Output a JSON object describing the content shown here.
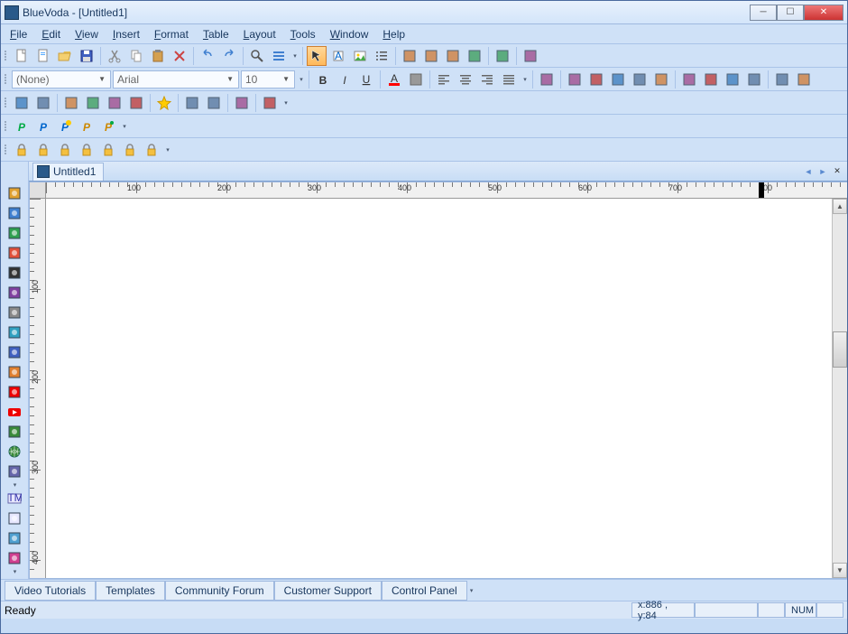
{
  "app": {
    "title": "BlueVoda - [Untitled1]"
  },
  "menu": [
    "File",
    "Edit",
    "View",
    "Insert",
    "Format",
    "Table",
    "Layout",
    "Tools",
    "Window",
    "Help"
  ],
  "toolbar1_icons": [
    "new-file",
    "page",
    "open",
    "save",
    "|",
    "cut",
    "copy",
    "paste",
    "delete",
    "|",
    "undo",
    "redo",
    "|",
    "zoom",
    "headers",
    "drop",
    "|",
    "cursor",
    "text-tool",
    "image-tool",
    "bullets",
    "|",
    "table-btn",
    "form-btn",
    "shape",
    "button",
    "|",
    "preview",
    "|",
    "publish"
  ],
  "format_row": {
    "style": "(None)",
    "font": "Arial",
    "size": "10"
  },
  "format_icons": [
    "bold",
    "italic",
    "underline",
    "|",
    "font-color",
    "fill-color",
    "|",
    "align-left",
    "align-center",
    "align-right",
    "align-justify",
    "drop",
    "|",
    "grid1",
    "|",
    "img-a",
    "img-b",
    "img-c",
    "img-d",
    "img-e",
    "|",
    "chart1",
    "chart2",
    "chart3",
    "chart4",
    "|",
    "tool-a",
    "tool-b"
  ],
  "toolbar3_icons": [
    "shape-a",
    "shape-b",
    "|",
    "obj-a",
    "obj-b",
    "obj-c",
    "obj-d",
    "|",
    "star",
    "|",
    "arrow-l",
    "arrow-r",
    "|",
    "box-a",
    "|",
    "box-b",
    "drop"
  ],
  "paypal_icons": [
    "paypal-1",
    "paypal-2",
    "paypal-3",
    "paypal-4",
    "paypal-5"
  ],
  "lock_icons": [
    "lock-a",
    "lock-b",
    "lock-c",
    "lock-d",
    "lock-e",
    "lock-f",
    "lock-g"
  ],
  "vtoolbar_icons": [
    "vt-1",
    "vt-2",
    "vt-3",
    "vt-4",
    "vt-5",
    "vt-6",
    "vt-7",
    "vt-8",
    "vt-9",
    "vt-10",
    "vt-11",
    "vt-youtube",
    "vt-13",
    "vt-globe",
    "vt-15",
    "vt-drop1",
    "vt-html",
    "vt-16",
    "vt-17",
    "vt-18",
    "vt-drop2"
  ],
  "doc_tab": "Untitled1",
  "ruler": {
    "marks_h": [
      100,
      200,
      300,
      400,
      500,
      600,
      700,
      800
    ],
    "marks_v": [
      100,
      200,
      300,
      400
    ]
  },
  "links": [
    "Video Tutorials",
    "Templates",
    "Community Forum",
    "Customer Support",
    "Control Panel"
  ],
  "status": {
    "ready": "Ready",
    "coords": "x:886 , y:84",
    "num": "NUM"
  }
}
